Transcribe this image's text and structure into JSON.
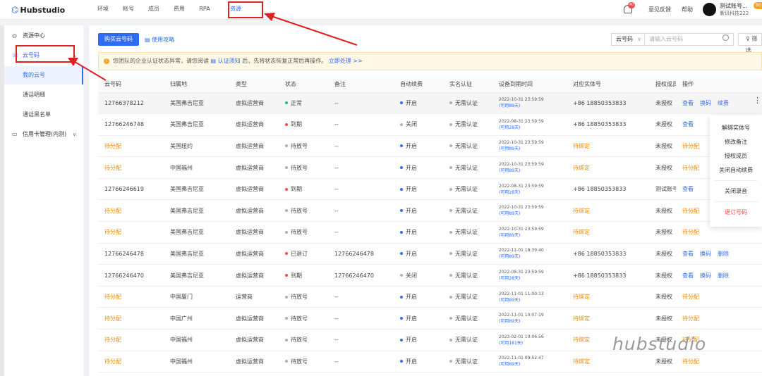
{
  "header": {
    "logo": "Hubstudio",
    "nav": [
      "环境",
      "帐号",
      "成员",
      "费用",
      "RPA",
      "资源"
    ],
    "active_nav": "资源",
    "notification_count": "40",
    "feedback": "意见反馈",
    "help": "帮助",
    "user_name": "测试账号...",
    "user_org": "紫讯科技222",
    "user_badge": "80"
  },
  "sidebar": {
    "items": [
      {
        "label": "资源中心",
        "icon": "compass-icon"
      },
      {
        "label": "云号码",
        "icon": "phone-icon"
      },
      {
        "label": "我的云号",
        "sub": true
      },
      {
        "label": "通话明细",
        "sub": true
      },
      {
        "label": "通话黑名单",
        "sub": true
      },
      {
        "label": "信用卡管理(内测)",
        "icon": "card-icon"
      }
    ]
  },
  "toolbar": {
    "buy_label": "购买云号码",
    "guide_label": "使用攻略",
    "select_value": "云号码",
    "search_placeholder": "请输入云号码",
    "filter_label": "筛选"
  },
  "warning": {
    "prefix": "您团队的企业认证状态异常，请您阅读",
    "link1": "认证须知",
    "middle": "后，先将状态恢复正常后再操作。",
    "link2": "立即处理 >>"
  },
  "table": {
    "columns": [
      "云号码",
      "归属地",
      "类型",
      "状态",
      "备注",
      "自动续费",
      "实名认证",
      "设备到期时间",
      "对应实体号",
      "授权成员",
      "操作"
    ],
    "rows": [
      {
        "num": "12766378212",
        "loc": "美国弗吉尼亚",
        "type": "虚拟运营商",
        "status": "正常",
        "sc": "green",
        "note": "--",
        "auto": "开启",
        "ac": "blue",
        "real": "无需认证",
        "date": "2022-10-31 23:59:59",
        "rem": "(可用89天)",
        "ent": "+86 18850353833",
        "auth": "未授权",
        "ops": [
          "查看",
          "换码",
          "续费"
        ]
      },
      {
        "num": "12766246748",
        "loc": "美国弗吉尼亚",
        "type": "虚拟运营商",
        "status": "到期",
        "sc": "red",
        "note": "--",
        "auto": "关闭",
        "ac": "gray",
        "real": "无需认证",
        "date": "2022-08-31 23:59:59",
        "rem": "(可用28天)",
        "ent": "+86 18850353833",
        "auth": "未授权",
        "ops": [
          "查看"
        ]
      },
      {
        "num": "待分配",
        "loc": "美国纽约",
        "type": "虚拟运营商",
        "status": "待放号",
        "sc": "gray",
        "note": "--",
        "auto": "开启",
        "ac": "blue",
        "real": "无需认证",
        "date": "2022-10-31 23:59:59",
        "rem": "(可用89天)",
        "ent": "待绑定",
        "auth": "未授权",
        "ops": [
          "待分配"
        ]
      },
      {
        "num": "待分配",
        "loc": "中国福州",
        "type": "虚拟运营商",
        "status": "待放号",
        "sc": "gray",
        "note": "--",
        "auto": "开启",
        "ac": "blue",
        "real": "无需认证",
        "date": "2022-10-31 23:59:59",
        "rem": "(可用89天)",
        "ent": "待绑定",
        "auth": "未授权",
        "ops": [
          "待分配"
        ]
      },
      {
        "num": "12766246619",
        "loc": "美国弗吉尼亚",
        "type": "虚拟运营商",
        "status": "到期",
        "sc": "red",
        "note": "--",
        "auto": "开启",
        "ac": "blue",
        "real": "无需认证",
        "date": "2022-08-31 23:59:59",
        "rem": "(可用28天)",
        "ent": "+86 18850353833",
        "auth": "测试账号",
        "ops": [
          "查看"
        ]
      },
      {
        "num": "待分配",
        "loc": "美国弗吉尼亚",
        "type": "虚拟运营商",
        "status": "待放号",
        "sc": "gray",
        "note": "--",
        "auto": "开启",
        "ac": "blue",
        "real": "无需认证",
        "date": "2022-10-31 23:59:59",
        "rem": "(可用89天)",
        "ent": "待绑定",
        "auth": "未授权",
        "ops": [
          "待分配"
        ]
      },
      {
        "num": "待分配",
        "loc": "美国弗吉尼亚",
        "type": "虚拟运营商",
        "status": "待放号",
        "sc": "gray",
        "note": "--",
        "auto": "开启",
        "ac": "blue",
        "real": "无需认证",
        "date": "2022-10-31 23:59:59",
        "rem": "(可用89天)",
        "ent": "待绑定",
        "auth": "未授权",
        "ops": [
          "待分配"
        ]
      },
      {
        "num": "12766246478",
        "loc": "美国弗吉尼亚",
        "type": "虚拟运营商",
        "status": "已退订",
        "sc": "red",
        "note": "12766246478",
        "auto": "开启",
        "ac": "blue",
        "real": "无需认证",
        "date": "2022-11-01 18:39:40",
        "rem": "(可用89天)",
        "ent": "+86 18850353833",
        "auth": "未授权",
        "ops": [
          "查看",
          "换码",
          "删除"
        ]
      },
      {
        "num": "12766246470",
        "loc": "美国弗吉尼亚",
        "type": "虚拟运营商",
        "status": "到期",
        "sc": "red",
        "note": "12766246470",
        "auto": "关闭",
        "ac": "gray",
        "real": "无需认证",
        "date": "2022-08-31 23:59:59",
        "rem": "(可用28天)",
        "ent": "+86 18850353833",
        "auth": "未授权",
        "ops": [
          "查看",
          "换码",
          "删除"
        ]
      },
      {
        "num": "待分配",
        "loc": "中国厦门",
        "type": "运营商",
        "status": "待放号",
        "sc": "gray",
        "note": "--",
        "auto": "开启",
        "ac": "blue",
        "real": "无需认证",
        "date": "2022-11-01 11:00:13",
        "rem": "(可用89天)",
        "ent": "待绑定",
        "auth": "未授权",
        "ops": [
          "待分配"
        ]
      },
      {
        "num": "待分配",
        "loc": "中国广州",
        "type": "虚拟运营商",
        "status": "待放号",
        "sc": "gray",
        "note": "--",
        "auto": "开启",
        "ac": "blue",
        "real": "无需认证",
        "date": "2022-11-01 10:07:19",
        "rem": "(可用89天)",
        "ent": "待绑定",
        "auth": "未授权",
        "ops": [
          "待分配"
        ]
      },
      {
        "num": "待分配",
        "loc": "中国福州",
        "type": "虚拟运营商",
        "status": "待放号",
        "sc": "gray",
        "note": "--",
        "auto": "开启",
        "ac": "blue",
        "real": "无需认证",
        "date": "2023-02-01 10:06:56",
        "rem": "(可用181天)",
        "ent": "待绑定",
        "auth": "未授权",
        "ops": [
          "待分配"
        ]
      },
      {
        "num": "待分配",
        "loc": "中国福州",
        "type": "虚拟运营商",
        "status": "待放号",
        "sc": "gray",
        "note": "--",
        "auto": "开启",
        "ac": "blue",
        "real": "无需认证",
        "date": "2022-11-01 09:52:47",
        "rem": "(可用89天)",
        "ent": "待绑定",
        "auth": "未授权",
        "ops": [
          "待分配"
        ]
      }
    ]
  },
  "menu": {
    "items": [
      "解绑实体号",
      "修改备注",
      "授权成员",
      "关闭自动续费",
      "关闭录音",
      "退订号码"
    ]
  },
  "watermark": "hubstudio"
}
